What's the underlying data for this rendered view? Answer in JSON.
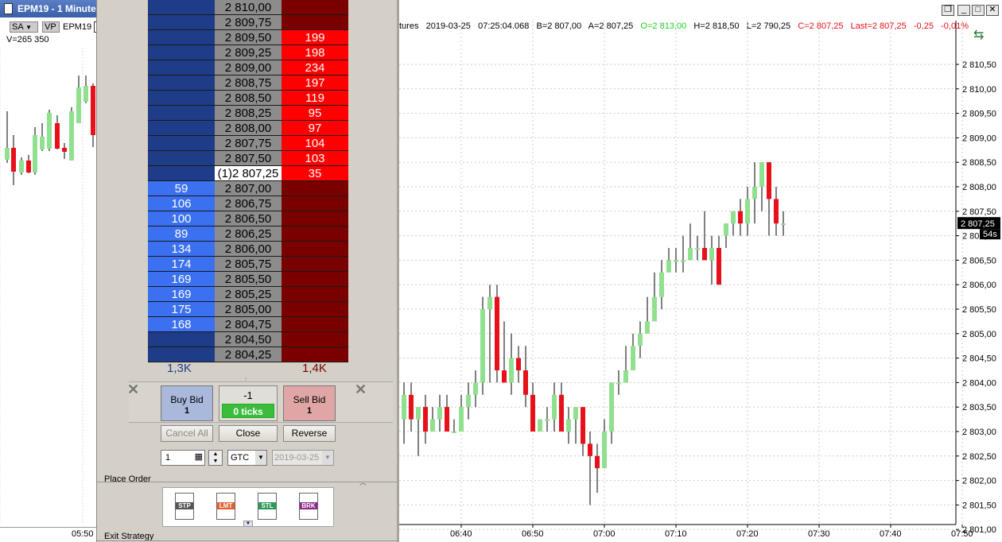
{
  "left_chart": {
    "title": "EPM19 - 1 Minute",
    "sa_label": "SA",
    "vp_label": "VP",
    "symbol": "EPM19",
    "volume_label": "V=265 350",
    "time_label": "05:50"
  },
  "dom": {
    "rows": [
      {
        "bid": "",
        "price": "2 810,00",
        "ask": ""
      },
      {
        "bid": "",
        "price": "2 809,75",
        "ask": ""
      },
      {
        "bid": "",
        "price": "2 809,50",
        "ask": "199"
      },
      {
        "bid": "",
        "price": "2 809,25",
        "ask": "198"
      },
      {
        "bid": "",
        "price": "2 809,00",
        "ask": "234"
      },
      {
        "bid": "",
        "price": "2 808,75",
        "ask": "197"
      },
      {
        "bid": "",
        "price": "2 808,50",
        "ask": "119"
      },
      {
        "bid": "",
        "price": "2 808,25",
        "ask": "95"
      },
      {
        "bid": "",
        "price": "2 808,00",
        "ask": "97"
      },
      {
        "bid": "",
        "price": "2 807,75",
        "ask": "104"
      },
      {
        "bid": "",
        "price": "2 807,50",
        "ask": "103"
      },
      {
        "bid": "",
        "price": "(1)2 807,25",
        "ask": "35"
      },
      {
        "bid": "59",
        "price": "2 807,00",
        "ask": ""
      },
      {
        "bid": "106",
        "price": "2 806,75",
        "ask": ""
      },
      {
        "bid": "100",
        "price": "2 806,50",
        "ask": ""
      },
      {
        "bid": "89",
        "price": "2 806,25",
        "ask": ""
      },
      {
        "bid": "134",
        "price": "2 806,00",
        "ask": ""
      },
      {
        "bid": "174",
        "price": "2 805,75",
        "ask": ""
      },
      {
        "bid": "169",
        "price": "2 805,50",
        "ask": ""
      },
      {
        "bid": "169",
        "price": "2 805,25",
        "ask": ""
      },
      {
        "bid": "175",
        "price": "2 805,00",
        "ask": ""
      },
      {
        "bid": "168",
        "price": "2 804,75",
        "ask": ""
      },
      {
        "bid": "",
        "price": "2 804,50",
        "ask": ""
      },
      {
        "bid": "",
        "price": "2 804,25",
        "ask": ""
      }
    ],
    "bid_total": "1,3K",
    "ask_total": "1,4K",
    "buy_bid": {
      "label": "Buy Bid",
      "qty": "1"
    },
    "position": {
      "value": "-1",
      "ticks": "0 ticks"
    },
    "sell_bid": {
      "label": "Sell Bid",
      "qty": "1"
    },
    "cancel_all": "Cancel All",
    "close": "Close",
    "reverse": "Reverse",
    "quantity": "1",
    "tif": "GTC",
    "date": "2019-03-25",
    "place_order_label": "Place Order",
    "exit_strategy_label": "Exit Strategy",
    "order_types": [
      "STP",
      "LMT",
      "STL",
      "BRK"
    ],
    "colors": {
      "bid_dark": "#1f3c88",
      "bid_light": "#3b70f0",
      "price": "#8c8c8c",
      "ask_light": "#ff0000",
      "ask_dark": "#7a0000"
    }
  },
  "chart": {
    "header_info": {
      "symbol_fragment": "tures",
      "date": "2019-03-25",
      "time": "07:25:04.068",
      "bid": "B=2 807,00",
      "ask": "A=2 807,25",
      "open": "O=2 813,00",
      "high": "H=2 818,50",
      "low": "L=2 790,25",
      "close": "C=2 807,25",
      "last": "Last=2 807,25",
      "change": "-0,25",
      "change_pct": "-0,01%"
    },
    "price_labels": [
      "2 810,50",
      "2 810,00",
      "2 809,50",
      "2 809,00",
      "2 808,50",
      "2 808,00",
      "2 807,50",
      "2 807,00",
      "2 806,50",
      "2 806,00",
      "2 805,50",
      "2 805,00",
      "2 804,50",
      "2 804,00",
      "2 803,50",
      "2 803,00",
      "2 802,50",
      "2 802,00",
      "2 801,50",
      "2 801,00"
    ],
    "last_price_tag": "2 807,25",
    "countdown_tag": "54s",
    "time_labels": [
      "06:40",
      "06:50",
      "07:00",
      "07:10",
      "07:20",
      "07:30",
      "07:40",
      "07:50"
    ],
    "colors": {
      "up": "#90e090",
      "down": "#e8101a"
    }
  },
  "chart_data": {
    "type": "candlestick",
    "x": [
      "06:32",
      "06:33",
      "06:34",
      "06:35",
      "06:36",
      "06:37",
      "06:38",
      "06:39",
      "06:40",
      "06:41",
      "06:42",
      "06:43",
      "06:44",
      "06:45",
      "06:46",
      "06:47",
      "06:48",
      "06:49",
      "06:50",
      "06:51",
      "06:52",
      "06:53",
      "06:54",
      "06:55",
      "06:56",
      "06:57",
      "06:58",
      "06:59",
      "07:00",
      "07:01",
      "07:02",
      "07:03",
      "07:04",
      "07:05",
      "07:06",
      "07:07",
      "07:08",
      "07:09",
      "07:10",
      "07:11",
      "07:12",
      "07:13",
      "07:14",
      "07:15",
      "07:16",
      "07:17",
      "07:18",
      "07:19",
      "07:20",
      "07:21",
      "07:22",
      "07:23",
      "07:24",
      "07:25"
    ],
    "open": [
      2803.25,
      2803.75,
      2803.25,
      2803.5,
      2803.0,
      2803.25,
      2803.5,
      2803.0,
      2803.0,
      2803.5,
      2803.75,
      2804.0,
      2805.5,
      2805.75,
      2804.25,
      2804.0,
      2804.5,
      2804.25,
      2803.75,
      2803.0,
      2803.25,
      2803.25,
      2803.75,
      2803.0,
      2803.25,
      2803.5,
      2802.75,
      2802.5,
      2802.25,
      2803.0,
      2804.0,
      2804.0,
      2804.25,
      2804.75,
      2805.0,
      2805.25,
      2805.75,
      2806.25,
      2806.5,
      2806.5,
      2806.5,
      2806.75,
      2806.75,
      2806.5,
      2806.75,
      2807.0,
      2807.25,
      2807.5,
      2807.25,
      2807.75,
      2808.0,
      2808.5,
      2807.75,
      2807.25
    ],
    "high": [
      2804.0,
      2804.0,
      2803.5,
      2803.75,
      2803.5,
      2803.75,
      2803.75,
      2803.25,
      2803.75,
      2804.0,
      2804.25,
      2805.75,
      2806.0,
      2806.0,
      2805.25,
      2805.0,
      2804.75,
      2804.75,
      2804.0,
      2803.25,
      2803.5,
      2804.0,
      2804.0,
      2803.5,
      2803.5,
      2803.5,
      2803.0,
      2802.75,
      2803.25,
      2804.0,
      2804.25,
      2804.75,
      2805.0,
      2805.25,
      2805.75,
      2806.25,
      2806.5,
      2806.75,
      2806.75,
      2807.0,
      2807.25,
      2807.0,
      2807.5,
      2807.0,
      2807.0,
      2807.25,
      2807.5,
      2807.75,
      2808.0,
      2808.5,
      2808.5,
      2808.5,
      2808.0,
      2807.5
    ],
    "low": [
      2802.75,
      2803.0,
      2802.5,
      2802.75,
      2803.0,
      2803.0,
      2803.25,
      2803.0,
      2803.0,
      2803.25,
      2803.5,
      2803.75,
      2804.0,
      2804.0,
      2804.0,
      2803.75,
      2804.0,
      2803.5,
      2803.0,
      2803.0,
      2803.0,
      2803.0,
      2803.0,
      2802.75,
      2802.75,
      2802.5,
      2801.5,
      2801.75,
      2802.25,
      2802.75,
      2803.75,
      2804.0,
      2804.25,
      2804.5,
      2805.0,
      2805.25,
      2805.5,
      2806.25,
      2806.25,
      2806.25,
      2806.5,
      2806.5,
      2806.5,
      2806.0,
      2806.0,
      2806.75,
      2807.0,
      2807.0,
      2807.0,
      2807.25,
      2807.5,
      2807.0,
      2807.0,
      2807.0
    ],
    "close": [
      2803.75,
      2803.25,
      2803.5,
      2803.0,
      2803.25,
      2803.5,
      2803.0,
      2803.0,
      2803.5,
      2803.75,
      2804.0,
      2805.5,
      2805.75,
      2804.25,
      2804.0,
      2804.5,
      2804.25,
      2803.75,
      2803.0,
      2803.25,
      2803.25,
      2803.75,
      2803.0,
      2803.25,
      2803.5,
      2802.75,
      2802.5,
      2802.25,
      2803.0,
      2804.0,
      2804.0,
      2804.25,
      2804.75,
      2805.0,
      2805.25,
      2805.75,
      2806.25,
      2806.5,
      2806.5,
      2806.5,
      2806.75,
      2806.75,
      2806.5,
      2806.75,
      2806.0,
      2807.25,
      2807.5,
      2807.25,
      2807.75,
      2808.0,
      2808.5,
      2807.75,
      2807.25,
      2807.25
    ],
    "ylim": [
      2801.0,
      2810.75
    ],
    "xlabel": "",
    "ylabel": "",
    "grid": true
  }
}
